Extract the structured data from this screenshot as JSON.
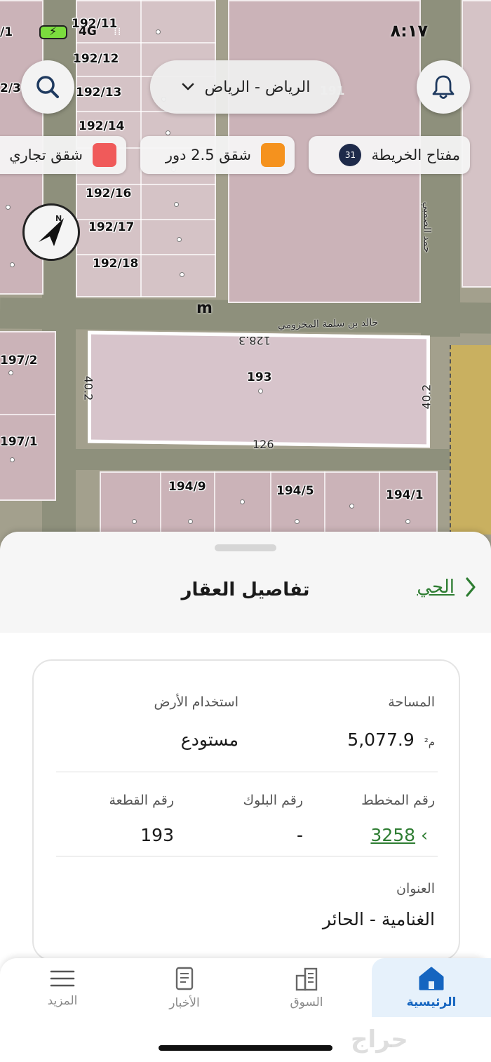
{
  "status_bar": {
    "time": "٨:١٧",
    "network": "4G"
  },
  "map": {
    "city_selector": "الرياض - الرياض",
    "legend_chips": {
      "map_key_label": "مفتاح الخريطة",
      "map_key_count": "31",
      "apartments_floors_label": "شقق 2.5 دور",
      "apartments_floors_color": "#f5921e",
      "commercial_label": "شقق تجاري",
      "commercial_color": "#f05a5a"
    },
    "compass_label": "N",
    "compass_m": "m",
    "plot_labels": [
      "192/11",
      "192/12",
      "192/13",
      "192/14",
      "192/16",
      "192/17",
      "192/18",
      "193",
      "194/9",
      "194/5",
      "194/1",
      "197/2",
      "197/1",
      "191",
      "2/3",
      "/1"
    ],
    "dimension_labels": {
      "top": "128.3",
      "bottom": "126",
      "left": "40.2",
      "right": "40.2"
    },
    "street_labels": {
      "main": "خالد بن سلمة المخزومي",
      "side": "حمد الصمبي"
    }
  },
  "sheet": {
    "title": "تفاصيل العقار",
    "district_link": "الحي",
    "fields": {
      "area_label": "المساحة",
      "area_value": "5,077.9",
      "area_unit": "م²",
      "land_use_label": "استخدام الأرض",
      "land_use_value": "مستودع",
      "plan_label": "رقم المخطط",
      "plan_value": "3258",
      "block_label": "رقم البلوك",
      "block_value": "-",
      "plot_label": "رقم القطعة",
      "plot_value": "193",
      "address_label": "العنوان",
      "address_value": "الغنامية - الحائر"
    }
  },
  "nav": {
    "home": "الرئيسية",
    "market": "السوق",
    "news": "الأخبار",
    "more": "المزيد",
    "active_color": "#1565c0"
  },
  "watermark": "حراج"
}
